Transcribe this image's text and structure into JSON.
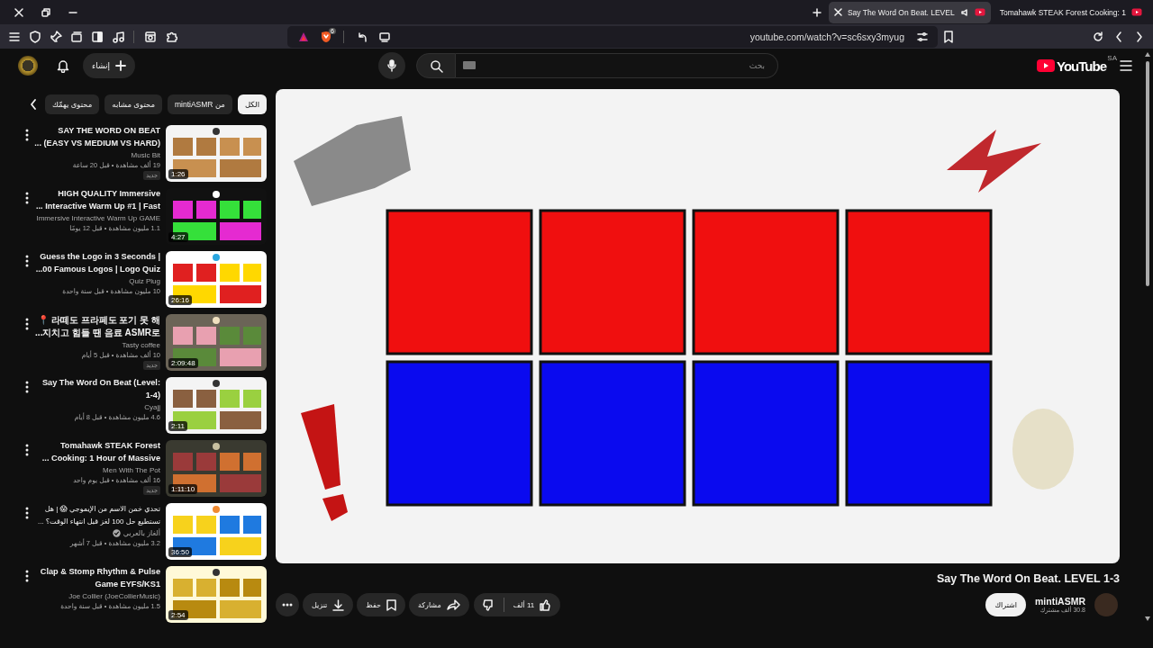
{
  "browser": {
    "tabs": [
      {
        "title": "Tomahawk STEAK Forest Cooking: 1",
        "selected": false
      },
      {
        "title": "Say The Word On Beat. LEVEL",
        "selected": true
      }
    ],
    "shield_badge": "6",
    "url": "youtube.com/watch?v=sc6sxy3myug"
  },
  "header": {
    "create_label": "إنشاء",
    "search_placeholder": "بحث",
    "logo": "YouTube",
    "region": "SA"
  },
  "chips": [
    {
      "label": "الكل",
      "selected": true
    },
    {
      "label": "من mintiASMR",
      "selected": false
    },
    {
      "label": "محتوى مشابه",
      "selected": false
    },
    {
      "label": "محتوى يهمّك",
      "selected": false
    }
  ],
  "recommendations": [
    {
      "title_lines": [
        "SAY  THE WORD ON BEAT",
        "... (EASY VS MEDIUM VS HARD)"
      ],
      "channel": "Music Bit",
      "verified": false,
      "meta": "19 ألف مشاهدة • قبل 20 ساعة",
      "badge": "جديد",
      "duration": "1:26"
    },
    {
      "title_lines": [
        "HIGH QUALITY Immersive",
        "... Interactive Warm Up #1 | Fast"
      ],
      "channel": "Immersive Interactive Warm Up GAME",
      "verified": false,
      "meta": "1.1 مليون مشاهدة • قبل 12 يومًا",
      "duration": "4:27"
    },
    {
      "title_lines": [
        "Guess the Logo in 3 Seconds |",
        "...00 Famous Logos | Logo Quiz"
      ],
      "channel": "Quiz Plug",
      "verified": false,
      "meta": "10 مليون مشاهدة • قبل سنة واحدة",
      "duration": "26:16"
    },
    {
      "title_lines": [
        "📍 라떼도 프라페도 포기 못 해",
        "...지치고 힘들 땐 음료 ASMR로"
      ],
      "channel": "Tasty coffee",
      "verified": false,
      "meta": "10 ألف مشاهدة • قبل 5 أيام",
      "badge": "جديد",
      "duration": "2:09:48"
    },
    {
      "title_lines": [
        "Say The Word On Beat (Level:",
        "1-4)"
      ],
      "channel": "Cyajj",
      "verified": false,
      "meta": "4.6 مليون مشاهدة • قبل 8 أيام",
      "duration": "2:11"
    },
    {
      "title_lines": [
        "Tomahawk STEAK Forest",
        "... Cooking: 1 Hour of Massive"
      ],
      "channel": "Men With The Pot",
      "verified": false,
      "meta": "16 ألف مشاهدة • قبل يوم واحد",
      "badge": "جديد",
      "duration": "1:11:10"
    },
    {
      "title_lines": [
        "تحدي خمن الاسم من الإيموجي 😱 | هل",
        "تستطيع حل 100 لغز قبل انتهاء الوقت؟ ..."
      ],
      "channel": "ألغاز بالعربي",
      "verified": true,
      "meta": "3.2 مليون مشاهدة • قبل 7 أشهر",
      "duration": "36:50"
    },
    {
      "title_lines": [
        "Clap & Stomp Rhythm & Pulse",
        "Game   EYFS/KS1"
      ],
      "channel": "Joe Collier (JoeCollierMusic)",
      "verified": false,
      "meta": "1.5 مليون مشاهدة • قبل سنة واحدة",
      "duration": "2:54"
    }
  ],
  "video": {
    "title": "Say The Word On Beat. LEVEL 1-3",
    "channel": "mintiASMR",
    "subscribers": "30.8 ألف مشترك",
    "subscribe_label": "اشتراك",
    "likes": "11 ألف",
    "share_label": "مشاركة",
    "save_label": "حفظ",
    "download_label": "تنزيل"
  }
}
